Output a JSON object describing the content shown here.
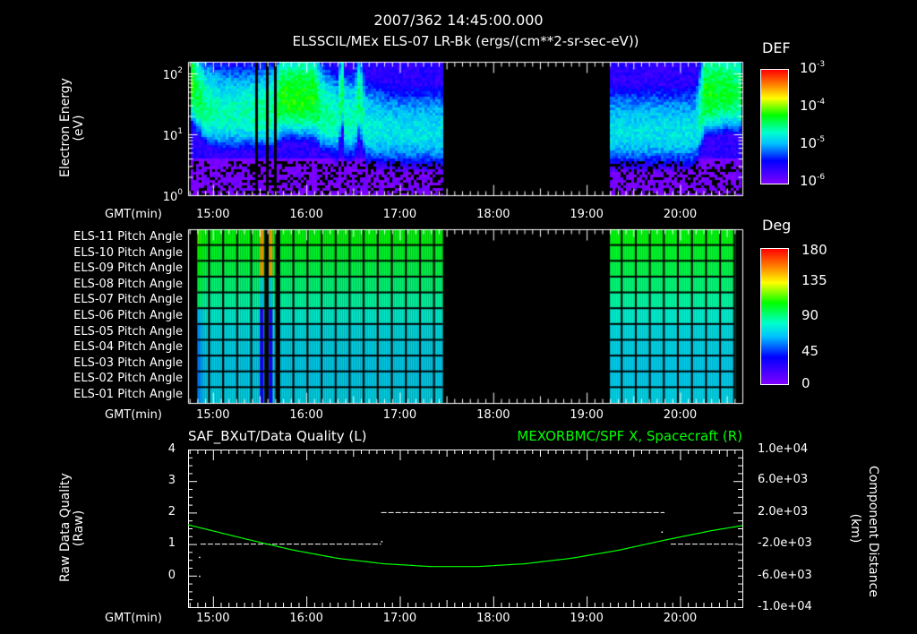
{
  "header": {
    "title": "2007/362 14:45:00.000"
  },
  "colors": {
    "background": "#000000",
    "axes": "#ffffff",
    "green_series": "#00ff00"
  },
  "chart_data": [
    {
      "type": "heatmap",
      "title": "ELSSCIL/MEx ELS-07 LR-Bk  (ergs/(cm**2-sr-sec-eV))",
      "ylabel": "Electron Energy",
      "ylabel_units": "(eV)",
      "yscale": "log",
      "ylim": [
        1,
        155
      ],
      "ytick_labels": [
        {
          "base": "10",
          "exp": "2"
        },
        {
          "base": "10",
          "exp": "1"
        },
        {
          "base": "10",
          "exp": "0"
        }
      ],
      "xlabel": "GMT(min)",
      "xlim_min_since_14h": [
        44,
        400
      ],
      "xtick_labels": [
        "15:00",
        "16:00",
        "17:00",
        "18:00",
        "19:00",
        "20:00"
      ],
      "colorbar": {
        "label": "DEF",
        "scale": "log",
        "range": [
          1e-06,
          0.001
        ],
        "tick_labels": [
          {
            "base": "10",
            "exp": "-3"
          },
          {
            "base": "10",
            "exp": "-4"
          },
          {
            "base": "10",
            "exp": "-5"
          },
          {
            "base": "10",
            "exp": "-6"
          }
        ]
      },
      "data_gaps_min": [
        [
          207.5,
          315
        ]
      ],
      "dropout_times_min": [
        88,
        95,
        99.5,
        100.5
      ],
      "peak_profile": {
        "t_min": [
          45,
          48,
          55,
          65,
          80,
          100,
          104,
          125,
          130,
          140,
          143,
          145,
          151,
          154,
          158,
          175,
          207,
          315,
          370,
          376,
          390,
          400
        ],
        "peak_energy_eV": [
          90,
          50,
          25,
          20,
          20,
          22,
          35,
          35,
          20,
          15,
          50,
          15,
          15,
          40,
          12,
          10,
          10,
          10,
          10,
          40,
          45,
          40
        ],
        "peak_log_def": [
          -4.0,
          -4.3,
          -4.5,
          -4.6,
          -4.6,
          -4.5,
          -4.2,
          -4.2,
          -4.5,
          -4.6,
          -4.4,
          -4.6,
          -4.6,
          -4.4,
          -4.7,
          -4.8,
          -4.8,
          -4.8,
          -4.8,
          -4.2,
          -4.3,
          -4.4
        ]
      }
    },
    {
      "type": "heatmap",
      "rows": [
        "ELS-11 Pitch Angle",
        "ELS-10 Pitch Angle",
        "ELS-09 Pitch Angle",
        "ELS-08 Pitch Angle",
        "ELS-07 Pitch Angle",
        "ELS-06 Pitch Angle",
        "ELS-05 Pitch Angle",
        "ELS-04 Pitch Angle",
        "ELS-03 Pitch Angle",
        "ELS-02 Pitch Angle",
        "ELS-01 Pitch Angle"
      ],
      "row_values_deg": [
        106,
        102,
        98,
        92,
        86,
        78,
        72,
        70,
        68,
        68,
        70
      ],
      "anomaly_times_min": [
        90.5,
        96.5
      ],
      "anomaly_top_deg": 150,
      "anomaly_bottom_deg": 20,
      "xlabel": "GMT(min)",
      "xtick_labels": [
        "15:00",
        "16:00",
        "17:00",
        "18:00",
        "19:00",
        "20:00"
      ],
      "colorbar": {
        "label": "Deg",
        "range": [
          0,
          180
        ],
        "tick_labels": [
          "180",
          "135",
          "90",
          "45",
          "0"
        ]
      },
      "data_segments_min": [
        [
          50,
          207.5
        ],
        [
          315,
          395
        ]
      ]
    },
    {
      "type": "line",
      "title_left": "SAF_BXuT/Data Quality (L)",
      "title_right": "MEXORBMC/SPF X, Spacecraft (R)",
      "ylabel_left": "Raw Data Quality",
      "ylabel_left_units": "(Raw)",
      "ylabel_right": "Component Distance",
      "ylabel_right_units": "(km)",
      "ylim_left": [
        -1,
        4
      ],
      "ytick_labels_left": [
        "4",
        "3",
        "2",
        "1",
        "0"
      ],
      "ylim_right": [
        -10000,
        10000
      ],
      "ytick_labels_right": [
        "1.0e+04",
        "6.0e+03",
        "2.0e+03",
        "-2.0e+03",
        "-6.0e+03",
        "-1.0e+04"
      ],
      "xlabel": "GMT(min)",
      "xtick_labels": [
        "15:00",
        "16:00",
        "17:00",
        "18:00",
        "19:00",
        "20:00"
      ],
      "quality_segments": [
        {
          "t_start": 52,
          "t_end": 168,
          "value": 1
        },
        {
          "t_start": 168,
          "t_end": 350,
          "value": 2
        },
        {
          "t_start": 354,
          "t_end": 397,
          "value": 1
        }
      ],
      "quality_points": [
        {
          "t": 51,
          "value": 0
        },
        {
          "t": 51,
          "value": 0.6
        },
        {
          "t": 168,
          "value": 1.1
        },
        {
          "t": 348,
          "value": 1.4
        }
      ],
      "spacecraft_x_km": {
        "t_min": [
          44,
          80,
          110,
          140,
          170,
          200,
          230,
          260,
          290,
          320,
          350,
          380,
          400
        ],
        "value": [
          450,
          -1300,
          -2700,
          -3800,
          -4500,
          -4850,
          -4850,
          -4500,
          -3800,
          -2800,
          -1500,
          -300,
          350
        ]
      }
    }
  ]
}
